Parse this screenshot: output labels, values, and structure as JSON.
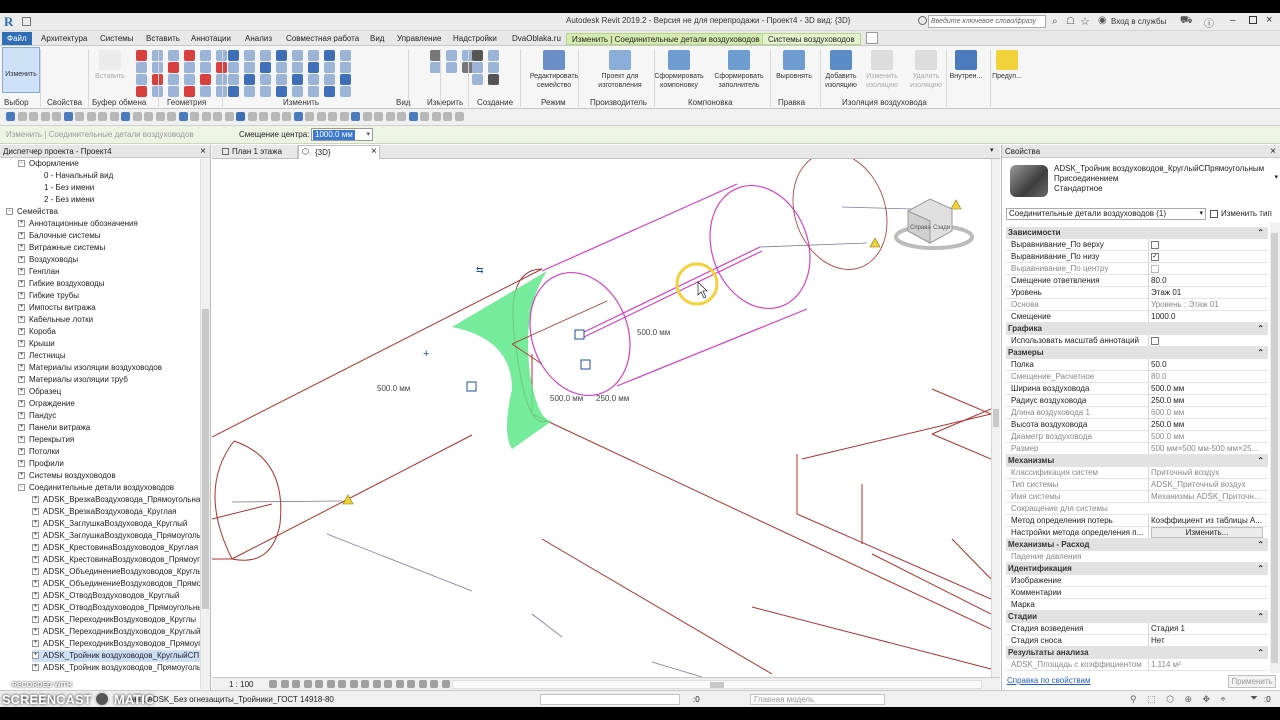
{
  "app": {
    "title": "Autodesk Revit 2019.2 - Версия не для перепродажи - Проект4 - 3D вид: {3D}",
    "search_placeholder": "Введите ключевое слово/фразу",
    "signin": "Вход в службы",
    "logo": "R"
  },
  "tabs": [
    "Файл",
    "Архитектура",
    "Системы",
    "Вставить",
    "Аннотации",
    "Анализ",
    "Совместная работа",
    "Вид",
    "Управление",
    "Надстройки",
    "DvaOblaka.ru",
    "Изменить | Соединительные детали воздуховодов",
    "Системы воздуховодов"
  ],
  "ribbon": {
    "buttons": [
      {
        "label": "Изменить"
      },
      {
        "label": "Вставить"
      },
      {
        "label": "Редактировать семейство"
      },
      {
        "label": "Проект для изготовления"
      },
      {
        "label": "Сформировать компоновку"
      },
      {
        "label": "Сформировать заполнитель"
      },
      {
        "label": "Выровнять"
      },
      {
        "label": "Добавить изоляцию"
      },
      {
        "label": "Изменить изоляцию"
      },
      {
        "label": "Удалить изоляцию"
      },
      {
        "label": "Внутрен..."
      },
      {
        "label": "Предуп..."
      }
    ],
    "panels": [
      "Выбор",
      "Свойства",
      "Буфер обмена",
      "Геометрия",
      "Изменить",
      "Вид",
      "Измерить",
      "Создание",
      "Режим",
      "Производитель",
      "Компоновка",
      "Правка",
      "Изоляция воздуховода"
    ]
  },
  "optionbar": {
    "context": "Изменить | Соединительные детали воздуховодов",
    "offset_label": "Смещение центра:",
    "offset_value": "1000.0 мм"
  },
  "browser": {
    "title": "Диспетчер проекта - Проект4",
    "items": [
      {
        "label": "Оформление",
        "level": 1,
        "toggle": "-"
      },
      {
        "label": "0 - Начальный вид",
        "level": 2,
        "toggle": ""
      },
      {
        "label": "1 - Без имени",
        "level": 2,
        "toggle": ""
      },
      {
        "label": "2 - Без имени",
        "level": 2,
        "toggle": ""
      },
      {
        "label": "Семейства",
        "level": 0,
        "toggle": "-"
      },
      {
        "label": "Аннотационные обозначения",
        "level": 1,
        "toggle": "+"
      },
      {
        "label": "Балочные системы",
        "level": 1,
        "toggle": "+"
      },
      {
        "label": "Витражные системы",
        "level": 1,
        "toggle": "+"
      },
      {
        "label": "Воздуховоды",
        "level": 1,
        "toggle": "+"
      },
      {
        "label": "Генплан",
        "level": 1,
        "toggle": "+"
      },
      {
        "label": "Гибкие воздуховоды",
        "level": 1,
        "toggle": "+"
      },
      {
        "label": "Гибкие трубы",
        "level": 1,
        "toggle": "+"
      },
      {
        "label": "Импосты витража",
        "level": 1,
        "toggle": "+"
      },
      {
        "label": "Кабельные лотки",
        "level": 1,
        "toggle": "+"
      },
      {
        "label": "Короба",
        "level": 1,
        "toggle": "+"
      },
      {
        "label": "Крыши",
        "level": 1,
        "toggle": "+"
      },
      {
        "label": "Лестницы",
        "level": 1,
        "toggle": "+"
      },
      {
        "label": "Материалы изоляции воздуховодов",
        "level": 1,
        "toggle": "+"
      },
      {
        "label": "Материалы изоляции труб",
        "level": 1,
        "toggle": "+"
      },
      {
        "label": "Образец",
        "level": 1,
        "toggle": "+"
      },
      {
        "label": "Ограждение",
        "level": 1,
        "toggle": "+"
      },
      {
        "label": "Пандус",
        "level": 1,
        "toggle": "+"
      },
      {
        "label": "Панели витража",
        "level": 1,
        "toggle": "+"
      },
      {
        "label": "Перекрытия",
        "level": 1,
        "toggle": "+"
      },
      {
        "label": "Потолки",
        "level": 1,
        "toggle": "+"
      },
      {
        "label": "Профили",
        "level": 1,
        "toggle": "+"
      },
      {
        "label": "Системы воздуховодов",
        "level": 1,
        "toggle": "+"
      },
      {
        "label": "Соединительные детали воздуховодов",
        "level": 1,
        "toggle": "-"
      },
      {
        "label": "ADSK_ВрезкаВоздуховода_Прямоугольна",
        "level": 2,
        "toggle": "+"
      },
      {
        "label": "ADSK_ВрезкаВоздуховода_Круглая",
        "level": 2,
        "toggle": "+"
      },
      {
        "label": "ADSK_ЗаглушкаВоздуховода_Круглый",
        "level": 2,
        "toggle": "+"
      },
      {
        "label": "ADSK_ЗаглушкаВоздуховода_Прямоуголь",
        "level": 2,
        "toggle": "+"
      },
      {
        "label": "ADSK_КрестовинаВоздуховодов_Круглая",
        "level": 2,
        "toggle": "+"
      },
      {
        "label": "ADSK_КрестовинаВоздуховодов_Прямоуг",
        "level": 2,
        "toggle": "+"
      },
      {
        "label": "ADSK_ОбъединениеВоздуховодов_Круглы",
        "level": 2,
        "toggle": "+"
      },
      {
        "label": "ADSK_ОбъединениеВоздуховодов_Прямо",
        "level": 2,
        "toggle": "+"
      },
      {
        "label": "ADSK_ОтводВоздуховодов_Круглый",
        "level": 2,
        "toggle": "+"
      },
      {
        "label": "ADSK_ОтводВоздуховодов_Прямоугольны",
        "level": 2,
        "toggle": "+"
      },
      {
        "label": "ADSK_ПереходникВоздуховодов_Круглы",
        "level": 2,
        "toggle": "+"
      },
      {
        "label": "ADSK_ПереходникВоздуховодов_Круглый",
        "level": 2,
        "toggle": "+"
      },
      {
        "label": "ADSK_ПереходникВоздуховодов_Прямоуг",
        "level": 2,
        "toggle": "+"
      },
      {
        "label": "ADSK_Тройник воздуховодов_КруглыйСП",
        "level": 2,
        "toggle": "+",
        "selected": true
      },
      {
        "label": "ADSK_Тройник воздуховодов_Прямоуголь",
        "level": 2,
        "toggle": "+"
      }
    ]
  },
  "viewtabs": [
    {
      "label": "План 1 этажа",
      "active": false
    },
    {
      "label": "{3D}",
      "active": true
    }
  ],
  "canvas": {
    "dim1": "500.0 мм",
    "dim2": "500.0 мм",
    "dim3": "500.0 мм",
    "dim4": "250.0 мм",
    "viewcube_a": "Справа",
    "viewcube_b": "Сзади"
  },
  "viewbar": {
    "scale": "1 : 100"
  },
  "properties": {
    "title": "Свойства",
    "type_name": "ADSK_Тройник воздуховодов_КруглыйСПрямоугольнымПрисоединением",
    "type_sub": "Стандартное",
    "selector": "Соединительные детали воздуховодов (1)",
    "edit_type": "Изменить тип",
    "rows": [
      {
        "group": "Зависимости"
      },
      {
        "k": "Выравнивание_По верху",
        "cb": false
      },
      {
        "k": "Выравнивание_По низу",
        "cb": true
      },
      {
        "k": "Выравнивание_По центру",
        "cb": false,
        "grey": true
      },
      {
        "k": "Смещение ответвления",
        "v": "80.0"
      },
      {
        "k": "Уровень",
        "v": "Этаж 01"
      },
      {
        "k": "Основа",
        "v": "Уровень : Этаж 01",
        "grey": true
      },
      {
        "k": "Смещение",
        "v": "1000.0"
      },
      {
        "group": "Графика"
      },
      {
        "k": "Использовать масштаб аннотаций",
        "cb": false
      },
      {
        "group": "Размеры"
      },
      {
        "k": "Полка",
        "v": "50.0"
      },
      {
        "k": "Смещение_Расчетное",
        "v": "80.0",
        "grey": true
      },
      {
        "k": "Ширина воздуховода",
        "v": "500.0 мм"
      },
      {
        "k": "Радиус воздуховода",
        "v": "250.0 мм"
      },
      {
        "k": "Длина воздуховода 1",
        "v": "600.0 мм",
        "grey": true
      },
      {
        "k": "Высота воздуховода",
        "v": "250.0 мм"
      },
      {
        "k": "Диаметр воздуховода",
        "v": "500.0 мм",
        "grey": true
      },
      {
        "k": "Размер",
        "v": "500 мм×500 мм-500 мм×25...",
        "grey": true
      },
      {
        "group": "Механизмы"
      },
      {
        "k": "Классификация систем",
        "v": "Приточный воздух",
        "grey": true
      },
      {
        "k": "Тип системы",
        "v": "ADSK_Приточный воздух",
        "grey": true
      },
      {
        "k": "Имя системы",
        "v": "Механизмы ADSK_Приточн...",
        "grey": true
      },
      {
        "k": "Сокращение для системы",
        "v": "",
        "grey": true
      },
      {
        "k": "Метод определения потерь",
        "v": "Коэффициент из таблицы А..."
      },
      {
        "k": "Настройки метода определения п...",
        "v": "Изменить...",
        "button": true
      },
      {
        "group": "Механизмы - Расход"
      },
      {
        "k": "Падение давления",
        "v": "",
        "grey": true
      },
      {
        "group": "Идентификация"
      },
      {
        "k": "Изображение",
        "v": ""
      },
      {
        "k": "Комментарии",
        "v": ""
      },
      {
        "k": "Марка",
        "v": ""
      },
      {
        "group": "Стадии"
      },
      {
        "k": "Стадия возведения",
        "v": "Стадия 1"
      },
      {
        "k": "Стадия сноса",
        "v": "Нет"
      },
      {
        "group": "Результаты анализа"
      },
      {
        "k": "ADSK_Площадь с коэффициентом",
        "v": "1.114 м²",
        "grey": true
      }
    ],
    "help_link": "Справка по свойствам",
    "apply": "Применить"
  },
  "status": {
    "text": "ия : ADSK_Без огнезащиты_Тройники_ГОСТ 14918-80",
    "model": "Главная модель",
    "zero": ":0"
  },
  "watermark": {
    "line1": "RECORDED WITH",
    "line2": "SCREENCAST",
    "line3": "MATIC"
  },
  "colors": {
    "file_tab": "#2f6db4",
    "context_tab": "#e6f3ce",
    "duct_magenta": "#d63fc4",
    "duct_red": "#b03030",
    "insulation_green": "#5ee88a",
    "cursor_ring": "#f2d23a"
  }
}
